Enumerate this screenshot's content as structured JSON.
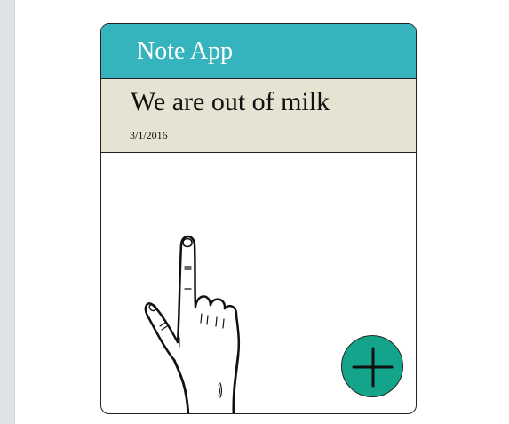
{
  "app": {
    "title": "Note App"
  },
  "notes": [
    {
      "title": "We are out of milk",
      "date": "3/1/2016"
    }
  ],
  "fab": {
    "icon": "plus-icon"
  },
  "gesture": {
    "icon": "pointing-hand-icon"
  },
  "colors": {
    "app_bar": "#36b4bd",
    "note_card": "#e5e4d3",
    "fab": "#14a38b",
    "outer_background": "#dfe3e5"
  }
}
